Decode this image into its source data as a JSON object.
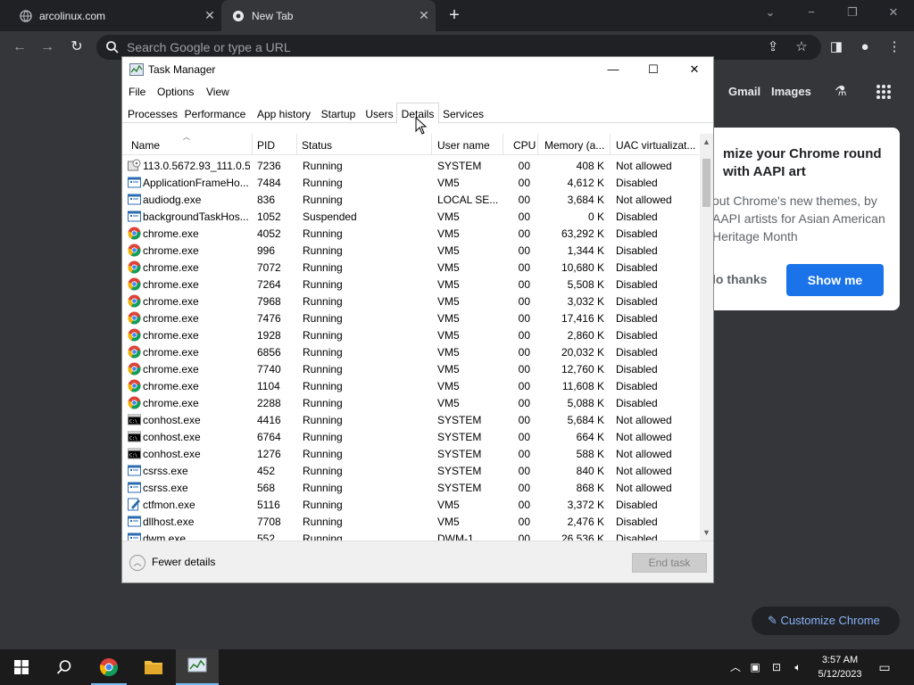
{
  "browser": {
    "tabs": [
      {
        "title": "arcolinux.com",
        "active": false
      },
      {
        "title": "New Tab",
        "active": true
      }
    ],
    "new_tab_symbol": "+",
    "omnibox_placeholder": "Search Google or type a URL",
    "window_min": "−",
    "window_restore": "❐",
    "window_close": "✕"
  },
  "ntp": {
    "links": [
      "Gmail",
      "Images"
    ],
    "promo": {
      "title": "mize your Chrome round with AAPI art",
      "body": "out Chrome's new themes, by AAPI artists for Asian American Heritage Month",
      "dismiss_label": "lo thanks",
      "accept_label": "Show me"
    },
    "customize_label": "Customize Chrome"
  },
  "task_manager": {
    "title": "Task Manager",
    "menu": [
      "File",
      "Options",
      "View"
    ],
    "tabs": [
      "Processes",
      "Performance",
      "App history",
      "Startup",
      "Users",
      "Details",
      "Services"
    ],
    "selected_tab": "Details",
    "columns": [
      "Name",
      "PID",
      "Status",
      "User name",
      "CPU",
      "Memory (a...",
      "UAC virtualizat..."
    ],
    "sort_column": "Name",
    "rows": [
      {
        "name": "113.0.5672.93_111.0.5...",
        "pid": "7236",
        "status": "Running",
        "user": "SYSTEM",
        "cpu": "00",
        "memory": "408 K",
        "uac": "Not allowed",
        "icon": "installer-icon"
      },
      {
        "name": "ApplicationFrameHo...",
        "pid": "7484",
        "status": "Running",
        "user": "VM5",
        "cpu": "00",
        "memory": "4,612 K",
        "uac": "Disabled",
        "icon": "app-window-icon"
      },
      {
        "name": "audiodg.exe",
        "pid": "836",
        "status": "Running",
        "user": "LOCAL SE...",
        "cpu": "00",
        "memory": "3,684 K",
        "uac": "Not allowed",
        "icon": "app-window-icon"
      },
      {
        "name": "backgroundTaskHos...",
        "pid": "1052",
        "status": "Suspended",
        "user": "VM5",
        "cpu": "00",
        "memory": "0 K",
        "uac": "Disabled",
        "icon": "app-window-icon"
      },
      {
        "name": "chrome.exe",
        "pid": "4052",
        "status": "Running",
        "user": "VM5",
        "cpu": "00",
        "memory": "63,292 K",
        "uac": "Disabled",
        "icon": "chrome-icon"
      },
      {
        "name": "chrome.exe",
        "pid": "996",
        "status": "Running",
        "user": "VM5",
        "cpu": "00",
        "memory": "1,344 K",
        "uac": "Disabled",
        "icon": "chrome-icon"
      },
      {
        "name": "chrome.exe",
        "pid": "7072",
        "status": "Running",
        "user": "VM5",
        "cpu": "00",
        "memory": "10,680 K",
        "uac": "Disabled",
        "icon": "chrome-icon"
      },
      {
        "name": "chrome.exe",
        "pid": "7264",
        "status": "Running",
        "user": "VM5",
        "cpu": "00",
        "memory": "5,508 K",
        "uac": "Disabled",
        "icon": "chrome-icon"
      },
      {
        "name": "chrome.exe",
        "pid": "7968",
        "status": "Running",
        "user": "VM5",
        "cpu": "00",
        "memory": "3,032 K",
        "uac": "Disabled",
        "icon": "chrome-icon"
      },
      {
        "name": "chrome.exe",
        "pid": "7476",
        "status": "Running",
        "user": "VM5",
        "cpu": "00",
        "memory": "17,416 K",
        "uac": "Disabled",
        "icon": "chrome-icon"
      },
      {
        "name": "chrome.exe",
        "pid": "1928",
        "status": "Running",
        "user": "VM5",
        "cpu": "00",
        "memory": "2,860 K",
        "uac": "Disabled",
        "icon": "chrome-icon"
      },
      {
        "name": "chrome.exe",
        "pid": "6856",
        "status": "Running",
        "user": "VM5",
        "cpu": "00",
        "memory": "20,032 K",
        "uac": "Disabled",
        "icon": "chrome-icon"
      },
      {
        "name": "chrome.exe",
        "pid": "7740",
        "status": "Running",
        "user": "VM5",
        "cpu": "00",
        "memory": "12,760 K",
        "uac": "Disabled",
        "icon": "chrome-icon"
      },
      {
        "name": "chrome.exe",
        "pid": "1104",
        "status": "Running",
        "user": "VM5",
        "cpu": "00",
        "memory": "11,608 K",
        "uac": "Disabled",
        "icon": "chrome-icon"
      },
      {
        "name": "chrome.exe",
        "pid": "2288",
        "status": "Running",
        "user": "VM5",
        "cpu": "00",
        "memory": "5,088 K",
        "uac": "Disabled",
        "icon": "chrome-icon"
      },
      {
        "name": "conhost.exe",
        "pid": "4416",
        "status": "Running",
        "user": "SYSTEM",
        "cpu": "00",
        "memory": "5,684 K",
        "uac": "Not allowed",
        "icon": "console-icon"
      },
      {
        "name": "conhost.exe",
        "pid": "6764",
        "status": "Running",
        "user": "SYSTEM",
        "cpu": "00",
        "memory": "664 K",
        "uac": "Not allowed",
        "icon": "console-icon"
      },
      {
        "name": "conhost.exe",
        "pid": "1276",
        "status": "Running",
        "user": "SYSTEM",
        "cpu": "00",
        "memory": "588 K",
        "uac": "Not allowed",
        "icon": "console-icon"
      },
      {
        "name": "csrss.exe",
        "pid": "452",
        "status": "Running",
        "user": "SYSTEM",
        "cpu": "00",
        "memory": "840 K",
        "uac": "Not allowed",
        "icon": "app-window-icon"
      },
      {
        "name": "csrss.exe",
        "pid": "568",
        "status": "Running",
        "user": "SYSTEM",
        "cpu": "00",
        "memory": "868 K",
        "uac": "Not allowed",
        "icon": "app-window-icon"
      },
      {
        "name": "ctfmon.exe",
        "pid": "5116",
        "status": "Running",
        "user": "VM5",
        "cpu": "00",
        "memory": "3,372 K",
        "uac": "Disabled",
        "icon": "pen-icon"
      },
      {
        "name": "dllhost.exe",
        "pid": "7708",
        "status": "Running",
        "user": "VM5",
        "cpu": "00",
        "memory": "2,476 K",
        "uac": "Disabled",
        "icon": "app-window-icon"
      },
      {
        "name": "dwm.exe",
        "pid": "552",
        "status": "Running",
        "user": "DWM-1",
        "cpu": "00",
        "memory": "26,536 K",
        "uac": "Disabled",
        "icon": "app-window-icon"
      }
    ],
    "fewer_details_label": "Fewer details",
    "end_task_label": "End task",
    "window_min": "—",
    "window_max": "☐",
    "window_close": "✕"
  },
  "taskbar": {
    "time": "3:57 AM",
    "date": "5/12/2023"
  },
  "colors": {
    "chrome_dark": "#202124",
    "chrome_mid": "#35363a",
    "accent_blue": "#1a73e8",
    "link_blue": "#8ab4f8"
  }
}
